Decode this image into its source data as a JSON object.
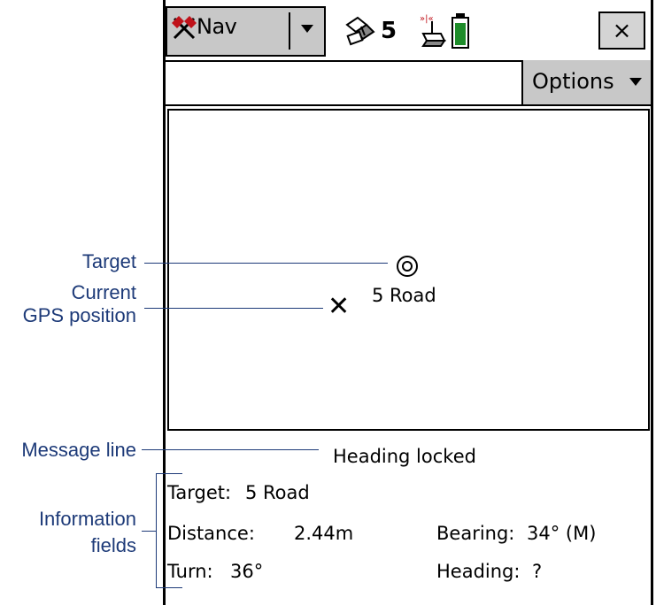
{
  "header": {
    "nav_label": "Nav",
    "satellite_count": "5",
    "close_label": "×",
    "icons": [
      "nav-tools-icon",
      "dropdown-arrow-icon",
      "satellite-icon",
      "antenna-icon",
      "battery-icon"
    ]
  },
  "command_bar": {
    "options_label": "Options"
  },
  "map": {
    "target_label": "5 Road"
  },
  "message_line": "Heading locked",
  "info": {
    "target_label": "Target:",
    "target_value": "5 Road",
    "distance_label": "Distance:",
    "distance_value": "2.44m",
    "bearing_label": "Bearing:",
    "bearing_value": "34° (M)",
    "turn_label": "Turn:",
    "turn_value": "36°",
    "heading_label": "Heading:",
    "heading_value": "?"
  },
  "annotations": {
    "target": "Target",
    "gps_line1": "Current",
    "gps_line2": "GPS position",
    "message": "Message line",
    "info_line1": "Information",
    "info_line2": "fields"
  },
  "colors": {
    "annotation": "#1d3a78",
    "button_gray": "#c8c8c8",
    "battery_green": "#1e8c2a"
  }
}
